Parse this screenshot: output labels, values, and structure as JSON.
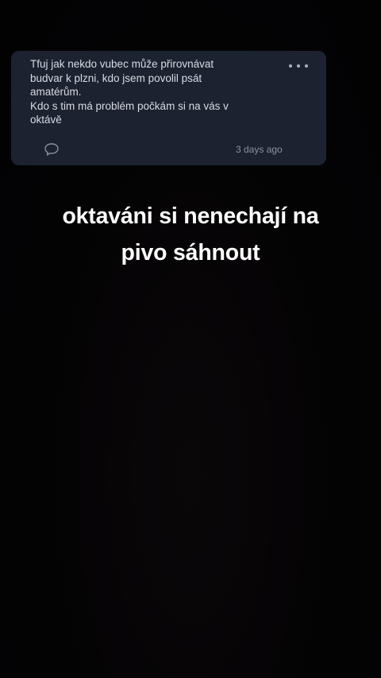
{
  "comment": {
    "text": "Tfuj jak nekdo vubec může přirovnávat\nbudvar k plzni, kdo jsem povolil psát\namatérům.\nKdo s tim má problém počkám si na vás v\noktávě",
    "timestamp": "3 days ago",
    "more_icon": "more-horizontal-icon",
    "reply_icon": "speech-bubble-icon"
  },
  "caption": {
    "text": "oktaváni si nenechají na\npivo sáhnout"
  },
  "colors": {
    "background": "#030304",
    "card": "#1c2230",
    "comment_text": "#d8dbe3",
    "meta_text": "#8b91a0"
  }
}
